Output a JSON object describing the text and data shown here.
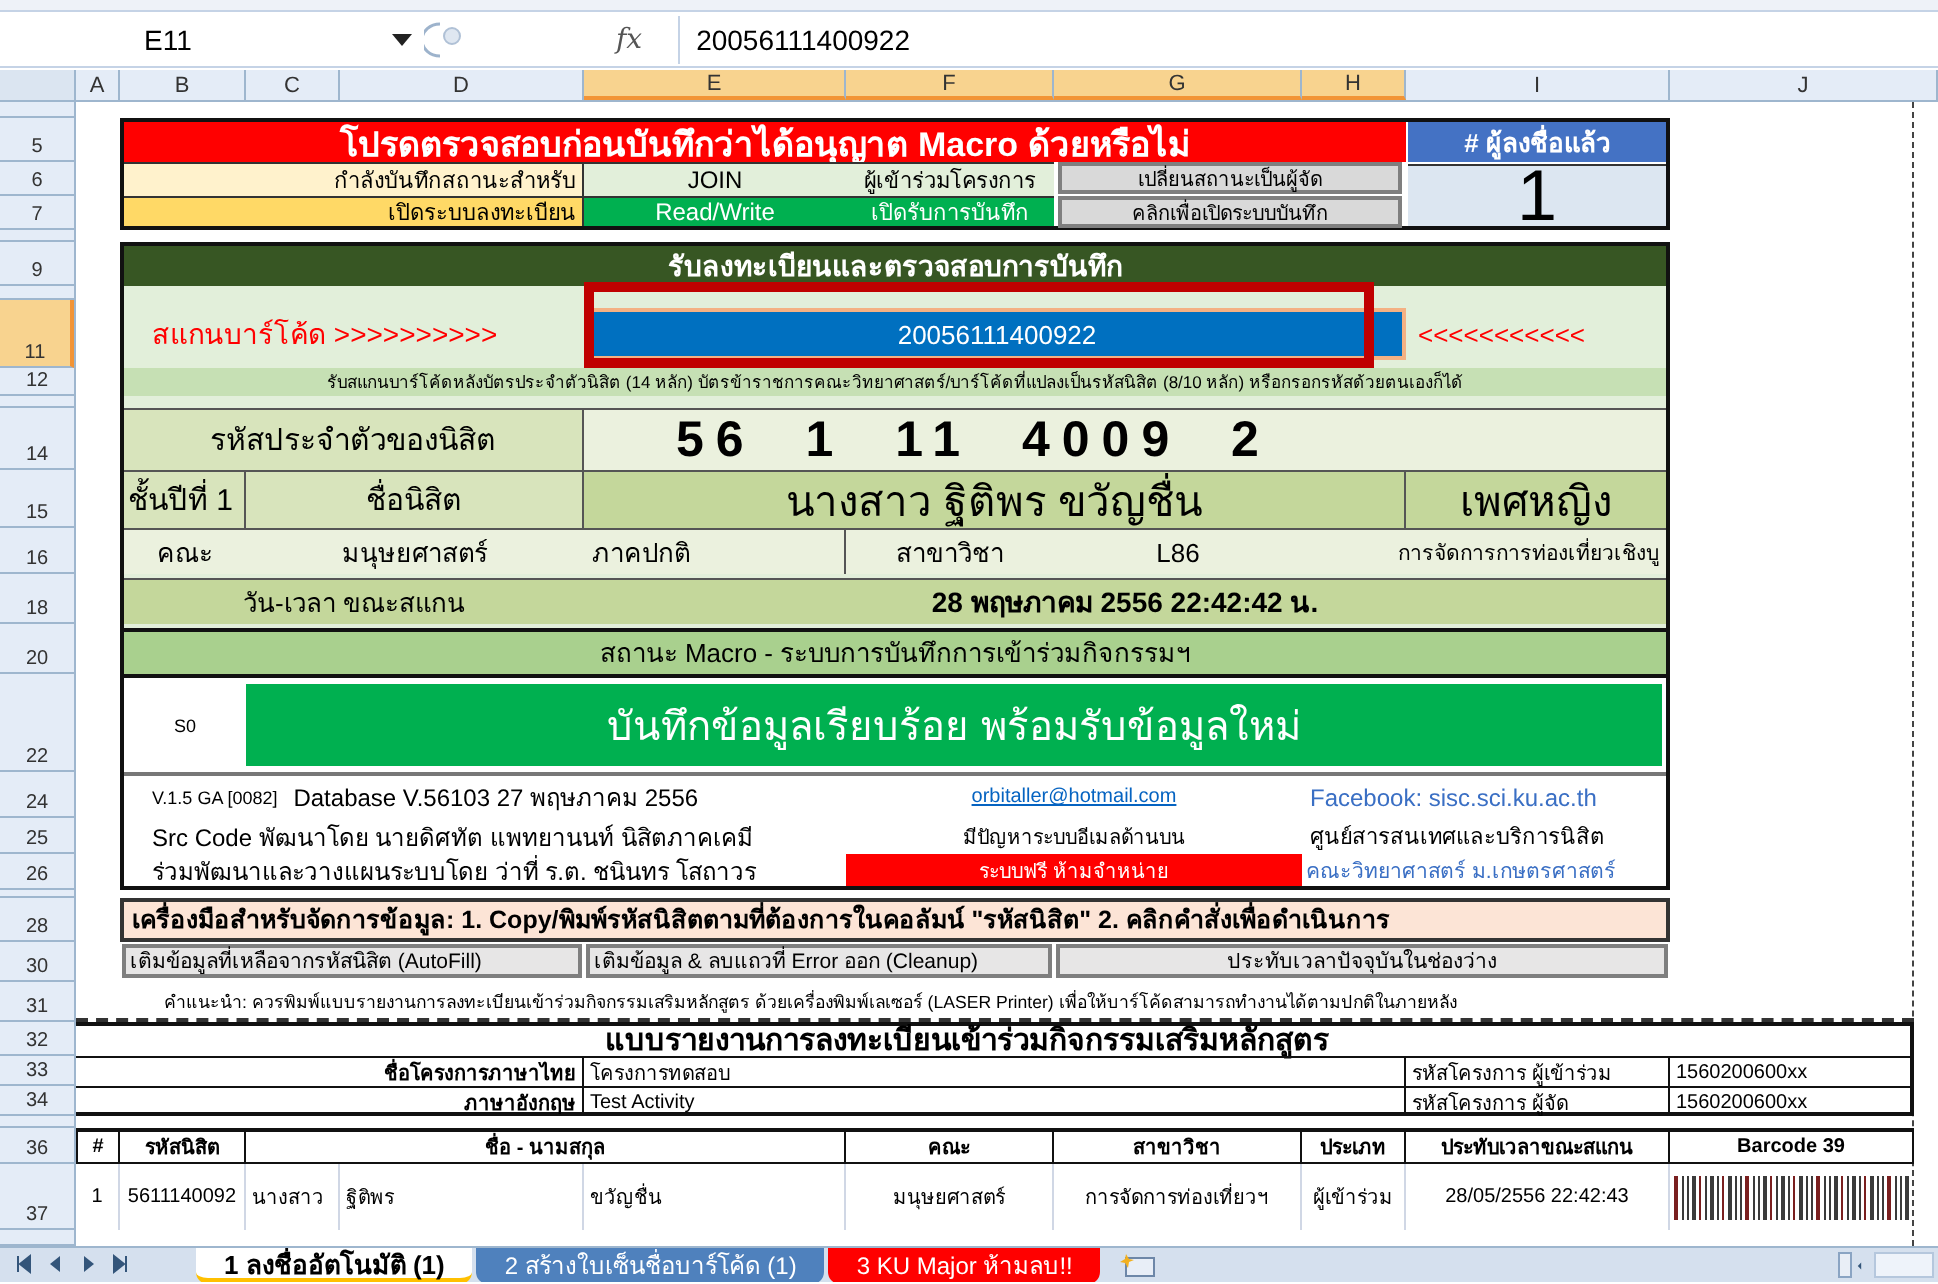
{
  "formula_bar": {
    "name_box": "E11",
    "function_label": "fx",
    "formula": "20056111400922"
  },
  "column_headers": [
    {
      "label": "A",
      "selected": false
    },
    {
      "label": "B",
      "selected": false
    },
    {
      "label": "C",
      "selected": false
    },
    {
      "label": "D",
      "selected": false
    },
    {
      "label": "E",
      "selected": true
    },
    {
      "label": "F",
      "selected": true
    },
    {
      "label": "G",
      "selected": true
    },
    {
      "label": "H",
      "selected": true
    },
    {
      "label": "I",
      "selected": false
    },
    {
      "label": "J",
      "selected": false
    }
  ],
  "row_headers": [
    {
      "label": "5",
      "selected": false
    },
    {
      "label": "6",
      "selected": false
    },
    {
      "label": "7",
      "selected": false
    },
    {
      "label": "9",
      "selected": false
    },
    {
      "label": "11",
      "selected": true
    },
    {
      "label": "12",
      "selected": false
    },
    {
      "label": "14",
      "selected": false
    },
    {
      "label": "15",
      "selected": false
    },
    {
      "label": "16",
      "selected": false
    },
    {
      "label": "18",
      "selected": false
    },
    {
      "label": "20",
      "selected": false
    },
    {
      "label": "22",
      "selected": false
    },
    {
      "label": "24",
      "selected": false
    },
    {
      "label": "25",
      "selected": false
    },
    {
      "label": "26",
      "selected": false
    },
    {
      "label": "28",
      "selected": false
    },
    {
      "label": "30",
      "selected": false
    },
    {
      "label": "31",
      "selected": false
    },
    {
      "label": "32",
      "selected": false
    },
    {
      "label": "33",
      "selected": false
    },
    {
      "label": "34",
      "selected": false
    },
    {
      "label": "36",
      "selected": false
    },
    {
      "label": "37",
      "selected": false
    }
  ],
  "header": {
    "title": "โปรดตรวจสอบก่อนบันทึกว่าได้อนุญาต Macro ด้วยหรือไม่",
    "counter_label": "# ผู้ลงชื่อแล้ว",
    "counter_value": "1",
    "mode_label": "กำลังบันทึกสถานะสำหรับ",
    "mode_value": "JOIN",
    "mode_role": "ผู้เข้าร่วมโครงการ",
    "mode_button": "เปลี่ยนสถานะเป็นผู้จัด",
    "system_label": "เปิดระบบลงทะเบียน",
    "system_value": "Read/Write",
    "system_status": "เปิดรับการบันทึก",
    "system_button": "คลิกเพื่อเปิดระบบบันทึก"
  },
  "registration": {
    "title": "รับลงทะเบียนและตรวจสอบการบันทึก",
    "scan_label": "สแกนบาร์โค้ด >>>>>>>>>>",
    "scan_value": "20056111400922",
    "scan_arrows": "<<<<<<<<<<<",
    "scan_hint": "รับสแกนบาร์โค้ดหลังบัตรประจำตัวนิสิต (14 หลัก) บัตรข้าราชการคณะวิทยาศาสตร์/บาร์โค้ดที่แปลงเป็นรหัสนิสิต (8/10 หลัก) หรือกรอกรหัสด้วยตนเองก็ได้",
    "student_id_label": "รหัสประจำตัวของนิสิต",
    "student_id": "56 1 11 4009 2",
    "year": "ชั้นปีที่  1",
    "name_label": "ชื่อนิสิต",
    "name": "นางสาว ฐิติพร  ขวัญชื่น",
    "gender": "เพศหญิง",
    "faculty_label": "คณะ",
    "faculty": "มนุษยศาสตร์",
    "program_type": "ภาคปกติ",
    "major_label": "สาขาวิชา",
    "major_code": "L86",
    "major": "การจัดการการท่องเที่ยวเชิงบู",
    "scan_time_label": "วัน-เวลา ขณะสแกน",
    "scan_time": "28 พฤษภาคม 2556 22:42:42 น.",
    "macro_label": "สถานะ Macro - ระบบการบันทึกการเข้าร่วมกิจกรรมฯ",
    "status_code": "S0",
    "status_message": "บันทึกข้อมูลเรียบร้อย พร้อมรับข้อมูลใหม่"
  },
  "credits": {
    "version": "V.1.5 GA [0082]",
    "database": "Database V.56103  27 พฤษภาคม 2556",
    "email": "orbitaller@hotmail.com",
    "facebook": "Facebook: sisc.sci.ku.ac.th",
    "developer": "Src Code พัฒนาโดย นายดิศทัต  แพทยานนท์ นิสิตภาคเคมี",
    "email_note": "มีปัญหาระบบอีเมลด้านบน",
    "center": "ศูนย์สารสนเทศและบริการนิสิต",
    "co_developer": "ร่วมพัฒนาและวางแผนระบบโดย ว่าที่ ร.ต. ชนินทร โสถาวร",
    "license": "ระบบฟรี ห้ามจำหน่าย",
    "faculty": "คณะวิทยาศาสตร์ ม.เกษตรศาสตร์"
  },
  "tools": {
    "title": "เครื่องมือสำหรับจัดการข้อมูล: 1. Copy/พิมพ์รหัสนิสิตตามที่ต้องการในคอลัมน์ \"รหัสนิสิต\" 2. คลิกคำสั่งเพื่อดำเนินการ",
    "buttons": [
      "เติมข้อมูลที่เหลือจากรหัสนิสิต (AutoFill)",
      "เติมข้อมูล & ลบแถวที่ Error ออก (Cleanup)",
      "ประทับเวลาปัจจุบันในช่องว่าง"
    ]
  },
  "note": "คำแนะนำ: ควรพิมพ์แบบรายงานการลงทะเบียนเข้าร่วมกิจกรรมเสริมหลักสูตร ด้วยเครื่องพิมพ์เลเซอร์ (LASER Printer) เพื่อให้บาร์โค้ดสามารถทำงานได้ตามปกติในภายหลัง",
  "report": {
    "title": "แบบรายงานการลงทะเบียนเข้าร่วมกิจกรรมเสริมหลักสูตร",
    "fields": [
      {
        "label": "ชื่อโครงการภาษาไทย",
        "value": "โครงการทดสอบ",
        "code_label": "รหัสโครงการ ผู้เข้าร่วม",
        "code": "1560200600xx"
      },
      {
        "label": "ภาษาอังกฤษ",
        "value": "Test Activity",
        "code_label": "รหัสโครงการ ผู้จัด",
        "code": "1560200600xx"
      }
    ],
    "columns": [
      "#",
      "รหัสนิสิต",
      "ชื่อ - นามสกุล",
      "คณะ",
      "สาขาวิชา",
      "ประเภท",
      "ประทับเวลาขณะสแกน",
      "Barcode 39"
    ],
    "rows": [
      {
        "cells": [
          "1",
          "5611140092",
          [
            "นางสาว",
            "ฐิติพร",
            "ขวัญชื่น"
          ],
          "มนุษยศาสตร์",
          "การจัดการท่องเที่ยวฯ",
          "ผู้เข้าร่วม",
          "28/05/2556 22:42:43"
        ]
      }
    ]
  },
  "sheet_tabs": [
    {
      "label": "1 ลงชื่ออัตโนมัติ (1)",
      "selected": true,
      "color": "#ffc000"
    },
    {
      "label": "2 สร้างใบเซ็นชื่อบาร์โค้ด (1)",
      "selected": false,
      "color": "#4f81bd"
    },
    {
      "label": "3 KU Major ห้ามลบ!!",
      "selected": false,
      "color": "#ff0000"
    }
  ]
}
